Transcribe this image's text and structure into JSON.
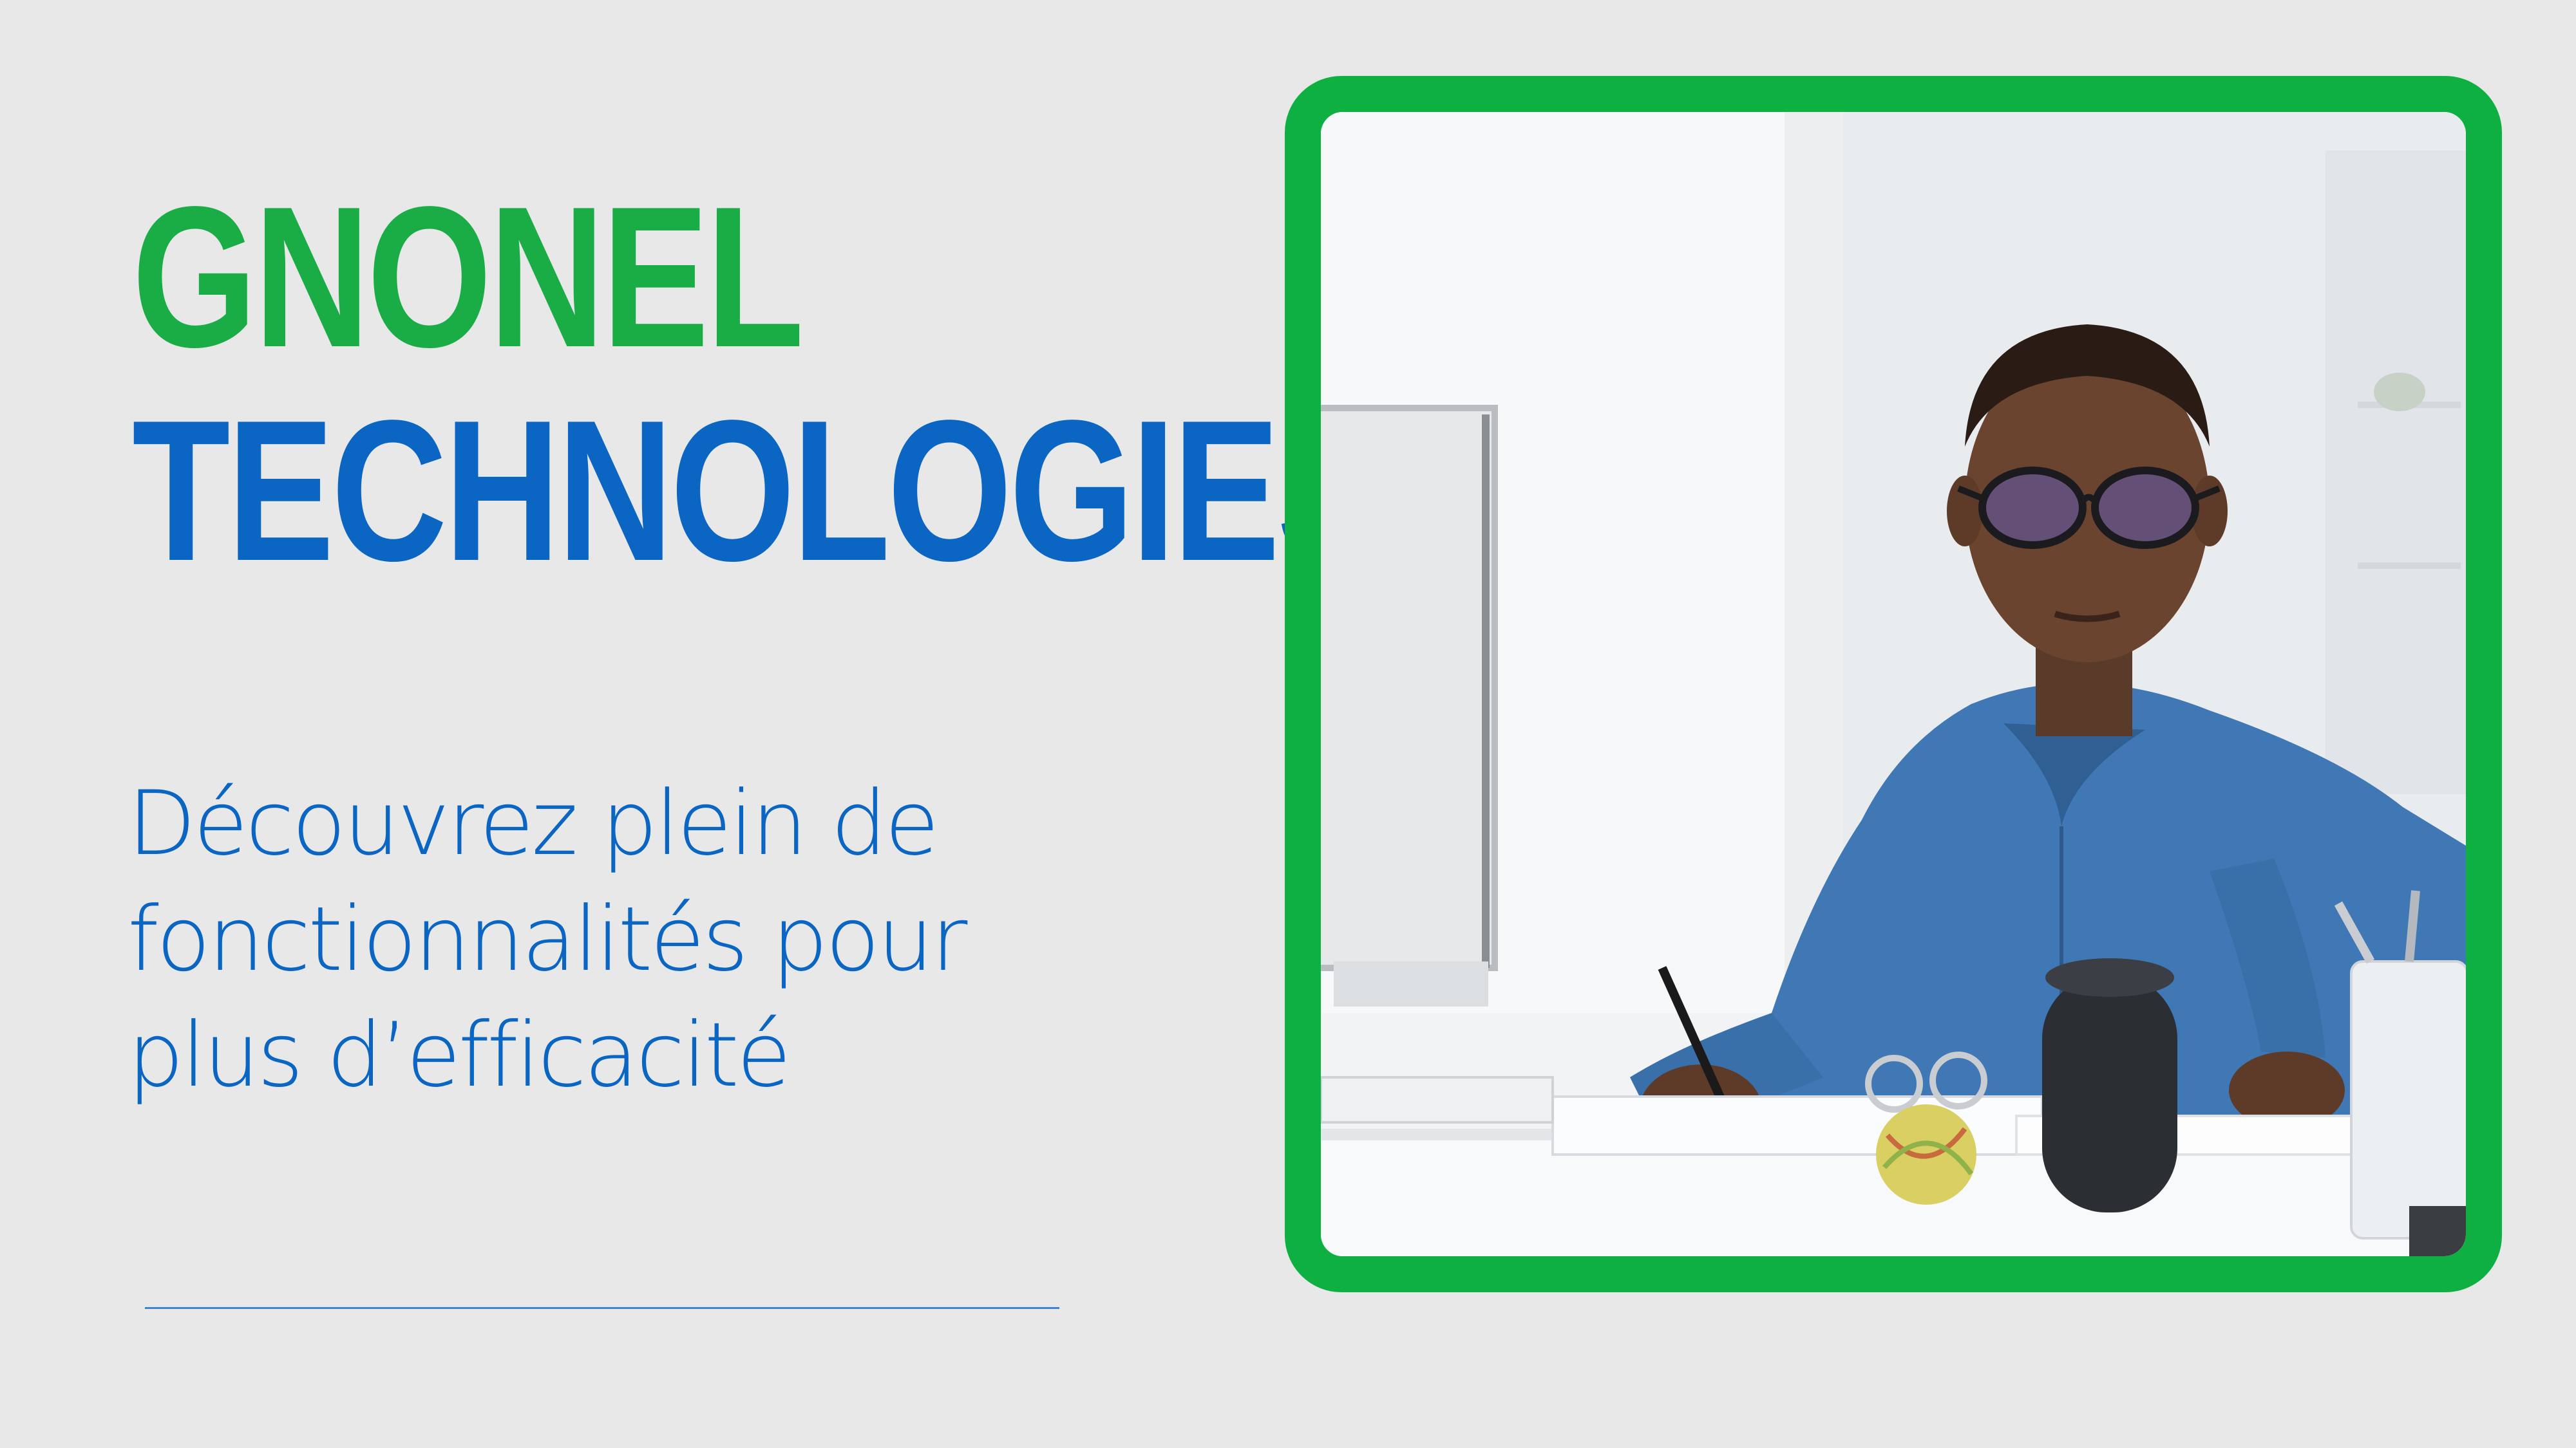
{
  "brand": {
    "line1": "GNONEL",
    "line2": "TECHNOLOGIES"
  },
  "tagline": {
    "line1": "Découvrez plein de",
    "line2": "fonctionnalités pour",
    "line3": "plus d’efficacité"
  },
  "colors": {
    "background": "#e8e8e8",
    "brand_green": "#1aad46",
    "brand_blue": "#0a66c2",
    "frame_green": "#0fb042"
  },
  "photo": {
    "subject": "man-working-at-desk-illustration"
  }
}
